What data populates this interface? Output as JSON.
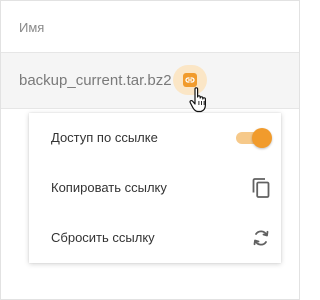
{
  "table": {
    "column_name": "Имя"
  },
  "file": {
    "name": "backup_current.tar.bz2"
  },
  "share_menu": {
    "items": [
      {
        "label": "Доступ по ссылке",
        "control": "toggle",
        "checked": true
      },
      {
        "label": "Копировать ссылку",
        "icon": "copy-icon"
      },
      {
        "label": "Сбросить ссылку",
        "icon": "refresh-icon"
      }
    ]
  },
  "colors": {
    "accent": "#f19b2c",
    "accent_light": "#fbe6c6",
    "toggle_track": "#f6c98a",
    "row_highlight": "#f5f5f5"
  }
}
